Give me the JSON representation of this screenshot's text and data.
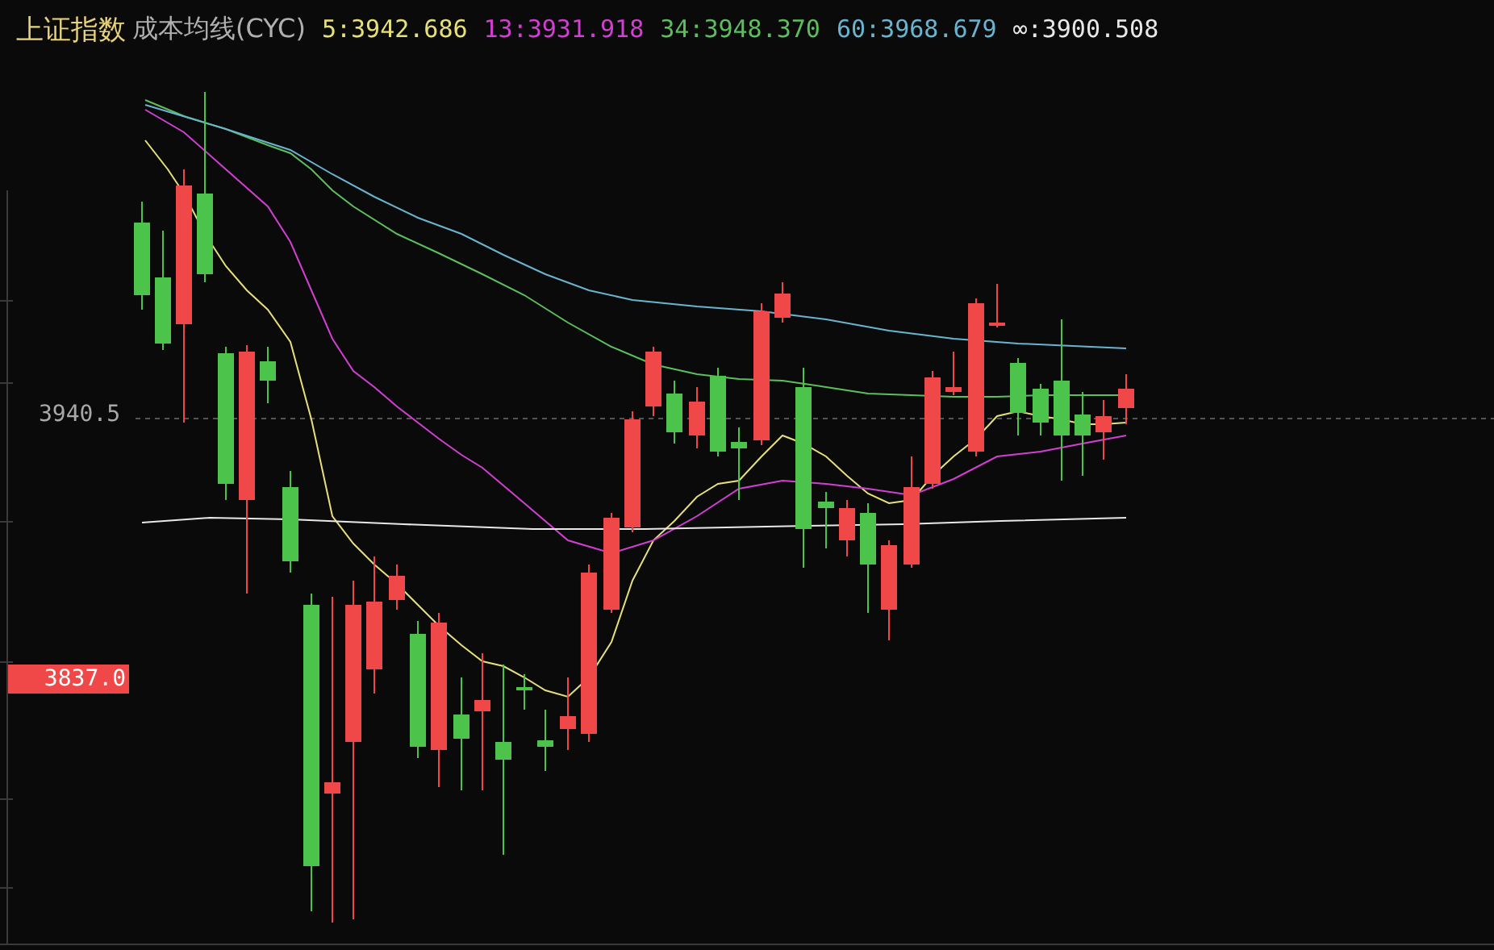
{
  "header": {
    "title": "上证指数",
    "subtitle": "成本均线(CYC)",
    "indicators": [
      {
        "label": "5:3942.686",
        "color": "#e6e07a"
      },
      {
        "label": "13:3931.918",
        "color": "#d23fd2"
      },
      {
        "label": "34:3948.370",
        "color": "#5cbf5c"
      },
      {
        "label": "60:3968.679",
        "color": "#6ab4d0"
      },
      {
        "label": "∞:3900.508",
        "color": "#e8e8e8"
      }
    ]
  },
  "axis": {
    "price_label": "3940.5",
    "marker_label": "3837.0"
  }
}
